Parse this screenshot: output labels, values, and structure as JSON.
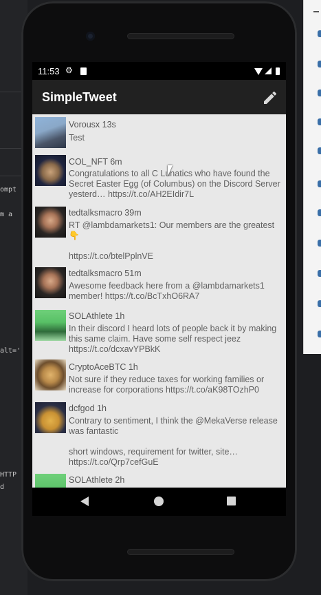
{
  "status_bar": {
    "time": "11:53"
  },
  "app_bar": {
    "title": "SimpleTweet"
  },
  "tweets": [
    {
      "user": "Vorousx",
      "age": "13s",
      "body": "Test"
    },
    {
      "user": "COL_NFT",
      "age": "6m",
      "body": "Congratulations to all C Lunatics who have found the Secret Easter Egg (of Columbus) on the Discord Server yesterd… https://t.co/AH2EIdir7L"
    },
    {
      "user": "tedtalksmacro",
      "age": "39m",
      "body": "RT @lambdamarkets1: Our members are the greatest 👇\n\nhttps://t.co/btelPplnVE"
    },
    {
      "user": "tedtalksmacro",
      "age": "51m",
      "body": "Awesome feedback here from a @lambdamarkets1 member! https://t.co/BcTxhO6RA7"
    },
    {
      "user": "SOLAthlete",
      "age": "1h",
      "body": "In their discord I heard lots of people back it by making this same claim. Have some self respect jeez https://t.co/dcxavYPBkK"
    },
    {
      "user": "CryptoAceBTC",
      "age": "1h",
      "body": "Not sure if they reduce taxes for working families or increase for corporations https://t.co/aK98TOzhP0"
    },
    {
      "user": "dcfgod",
      "age": "1h",
      "body": "Contrary to sentiment, I think the @MekaVerse release was fantastic\n\nshort windows, requirement for twitter, site… https://t.co/Qrp7cefGuE"
    },
    {
      "user": "SOLAthlete",
      "age": "2h",
      "body": ""
    }
  ],
  "ide_background": {
    "left_text": [
      "ompt",
      "m a",
      "alt='",
      "HTTP",
      "d"
    ]
  },
  "colors": {
    "app_bar": "#212121",
    "timeline_bg": "#e8e8e8",
    "text": "#616161"
  },
  "icons": [
    "compose-icon",
    "settings-icon",
    "sd-card-icon",
    "wifi-icon",
    "signal-icon",
    "battery-icon",
    "back-icon",
    "home-icon",
    "recents-icon"
  ]
}
